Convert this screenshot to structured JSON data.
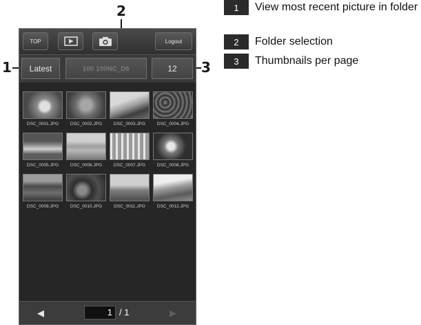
{
  "callouts": [
    "1",
    "2",
    "3"
  ],
  "legend": [
    {
      "num": "1",
      "text": "View most recent picture in folder"
    },
    {
      "num": "2",
      "text": "Folder selection"
    },
    {
      "num": "3",
      "text": "Thumbnails per page"
    }
  ],
  "topbar": {
    "top_label": "TOP",
    "play_icon": "playback-icon",
    "camera_icon": "camera-icon",
    "logout_label": "Logout"
  },
  "controls": {
    "latest_label": "Latest",
    "folder_value": "100 100NC_D6",
    "per_page_value": "12"
  },
  "thumbnails": [
    {
      "name": "DSC_0001.JPG"
    },
    {
      "name": "DSC_0002.JPG"
    },
    {
      "name": "DSC_0003.JPG"
    },
    {
      "name": "DSC_0004.JPG"
    },
    {
      "name": "DSC_0005.JPG"
    },
    {
      "name": "DSC_0006.JPG"
    },
    {
      "name": "DSC_0007.JPG"
    },
    {
      "name": "DSC_0008.JPG"
    },
    {
      "name": "DSC_0009.JPG"
    },
    {
      "name": "DSC_0010.JPG"
    },
    {
      "name": "DSC_0011.JPG"
    },
    {
      "name": "DSC_0012.JPG"
    }
  ],
  "pager": {
    "current_page": "1",
    "total_label": "/ 1",
    "prev_icon": "prev-arrow-icon",
    "next_icon": "next-arrow-icon"
  }
}
